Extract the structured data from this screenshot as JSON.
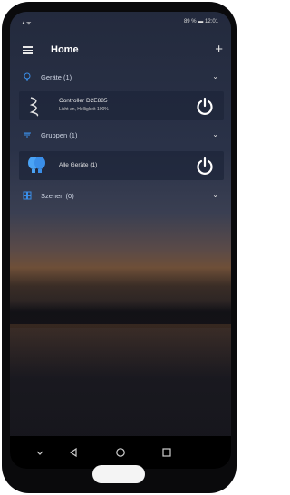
{
  "status": {
    "left": "▲ᯤ",
    "right": "89 % ▬ 12:01"
  },
  "appbar": {
    "title": "Home",
    "add": "+"
  },
  "sections": [
    {
      "label": "Geräte (1)",
      "icon": "lightbulb-icon"
    },
    {
      "label": "Gruppen (1)",
      "icon": "group-icon"
    },
    {
      "label": "Szenen (0)",
      "icon": "scenes-icon"
    }
  ],
  "device": {
    "name": "Controller D2E885",
    "status": "Licht an, Helligkeit 100%",
    "icon": "led-strip-icon"
  },
  "group": {
    "name": "Alle Geräte (1)",
    "icon": "bulbs-icon"
  },
  "nav": {
    "back": "back-icon",
    "home": "home-icon",
    "recents": "recents-icon"
  },
  "colors": {
    "accent": "#3a8ee8",
    "icon_blue": "#4aa3f5"
  }
}
